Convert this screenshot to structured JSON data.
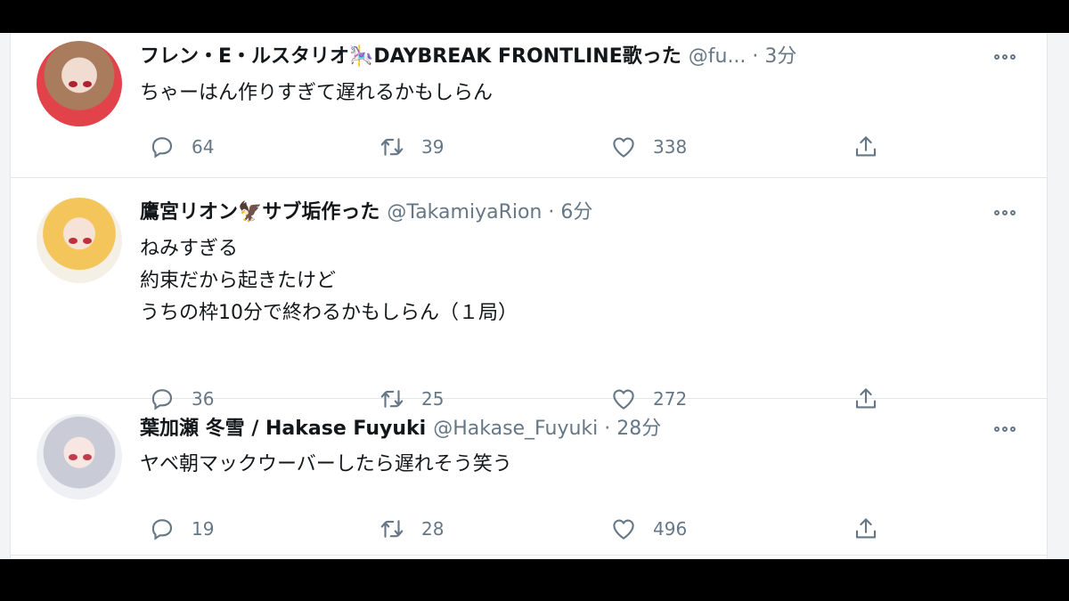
{
  "tweets": [
    {
      "display_name": "フレン・E・ルスタリオ🎠DAYBREAK FRONTLINE歌った",
      "handle": "@fu...",
      "time": "· 3分",
      "lines": [
        "ちゃーはん作りすぎて遅れるかもしらん"
      ],
      "replies": "64",
      "retweets": "39",
      "likes": "338"
    },
    {
      "display_name": "鷹宮リオン🦅サブ垢作った",
      "handle": "@TakamiyaRion",
      "time": "· 6分",
      "lines": [
        "ねみすぎる",
        "約束だから起きたけど",
        "うちの枠10分で終わるかもしらん（１局）"
      ],
      "replies": "36",
      "retweets": "25",
      "likes": "272"
    },
    {
      "display_name": "葉加瀬 冬雪 / Hakase Fuyuki",
      "handle": "@Hakase_Fuyuki",
      "time": "· 28分",
      "lines": [
        "ヤベ朝マックウーバーしたら遅れそう笑う"
      ],
      "replies": "19",
      "retweets": "28",
      "likes": "496"
    }
  ],
  "icons": {
    "reply": "reply-bubble-icon",
    "retweet": "retweet-arrows-icon",
    "like": "heart-icon",
    "share": "share-upload-icon",
    "more": "more-dots-icon"
  },
  "colors": {
    "text": "#14171a",
    "secondary": "#657786",
    "border": "#e1e8ed",
    "background": "#ffffff"
  }
}
